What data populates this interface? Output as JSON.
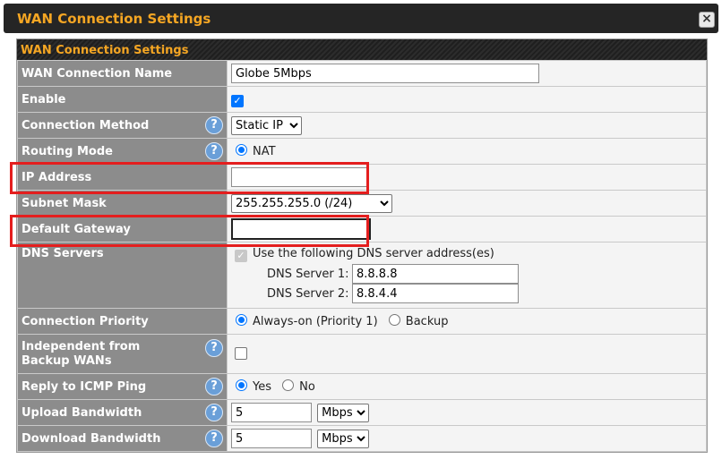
{
  "window": {
    "title": "WAN Connection Settings",
    "close_glyph": "×"
  },
  "panel": {
    "header": "WAN Connection Settings"
  },
  "fields": {
    "name": {
      "label": "WAN Connection Name",
      "value": "Globe 5Mbps"
    },
    "enable": {
      "label": "Enable",
      "checked": true
    },
    "method": {
      "label": "Connection Method",
      "value": "Static IP"
    },
    "routing": {
      "label": "Routing Mode",
      "option": "NAT"
    },
    "ip": {
      "label": "IP Address",
      "value": ""
    },
    "subnet": {
      "label": "Subnet Mask",
      "value": "255.255.255.0 (/24)"
    },
    "gateway": {
      "label": "Default Gateway",
      "value": ""
    },
    "dns": {
      "label": "DNS Servers",
      "use_label": "Use the following DNS server address(es)",
      "server1_label": "DNS Server 1:",
      "server1_value": "8.8.8.8",
      "server2_label": "DNS Server 2:",
      "server2_value": "8.8.4.4"
    },
    "priority": {
      "label": "Connection Priority",
      "opt1": "Always-on (Priority 1)",
      "opt2": "Backup"
    },
    "independent": {
      "label": "Independent from Backup WANs"
    },
    "icmp": {
      "label": "Reply to ICMP Ping",
      "opt_yes": "Yes",
      "opt_no": "No"
    },
    "upload": {
      "label": "Upload Bandwidth",
      "value": "5",
      "unit": "Mbps"
    },
    "download": {
      "label": "Download Bandwidth",
      "value": "5",
      "unit": "Mbps"
    }
  },
  "help_glyph": "?",
  "colors": {
    "accent": "#f5a623",
    "highlight": "#e41e1e",
    "label_bg": "#8c8c8c"
  }
}
